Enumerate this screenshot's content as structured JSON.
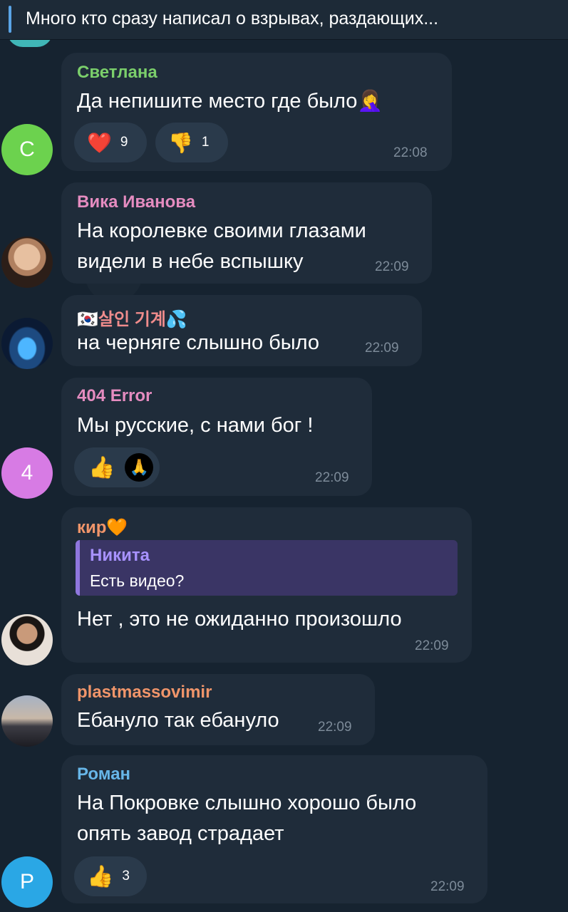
{
  "pinned": {
    "text": "Много кто сразу написал о взрывах, раздающих..."
  },
  "messages": [
    {
      "author": "Светлана",
      "author_color": "#7bcf6b",
      "avatar_letter": "С",
      "avatar_color": "#6cd24e",
      "text_lines": [
        "Да непишите место где было🤦‍♀️"
      ],
      "reactions": [
        {
          "icon": "heart-icon",
          "glyph": "❤️",
          "count": "9"
        },
        {
          "icon": "thumbs-down-icon",
          "glyph": "👎",
          "count": "1"
        }
      ],
      "time": "22:08"
    },
    {
      "author": "Вика Иванова",
      "author_color": "#e58cc0",
      "text_lines": [
        "На королевке своими глазами",
        "видели в небе вспышку"
      ],
      "time": "22:09"
    },
    {
      "author": "🇰🇷살인 기계💦",
      "author_color": "#f08c8c",
      "text_lines": [
        "на черняге слышно было"
      ],
      "time": "22:09"
    },
    {
      "author": "404 Error",
      "author_color": "#e58cc0",
      "avatar_letter": "4",
      "avatar_color": "#d77be4",
      "text_lines": [
        "Мы русские, с нами бог !"
      ],
      "reactions": [
        {
          "icon": "thumbs-up-icon",
          "glyph": "👍",
          "count": ""
        },
        {
          "icon": "custom-emoji-icon",
          "glyph": "🙏",
          "count": ""
        }
      ],
      "time": "22:09"
    },
    {
      "author": "кир🧡",
      "author_color": "#f0956a",
      "reply": {
        "name": "Никита",
        "text": "Есть видео?"
      },
      "text_lines": [
        "Нет , это не ожиданно произошло"
      ],
      "time": "22:09"
    },
    {
      "author": "plastmassovimir",
      "author_color": "#f0956a",
      "text_lines": [
        "Ебануло так ебануло"
      ],
      "time": "22:09"
    },
    {
      "author": "Роман",
      "author_color": "#67b6e8",
      "avatar_letter": "Р",
      "avatar_color": "#2aa7e5",
      "text_lines": [
        "На Покровке слышно хорошо было",
        "опять завод страдает"
      ],
      "reactions": [
        {
          "icon": "thumbs-up-icon",
          "glyph": "👍",
          "count": "3"
        }
      ],
      "time": "22:09"
    }
  ]
}
